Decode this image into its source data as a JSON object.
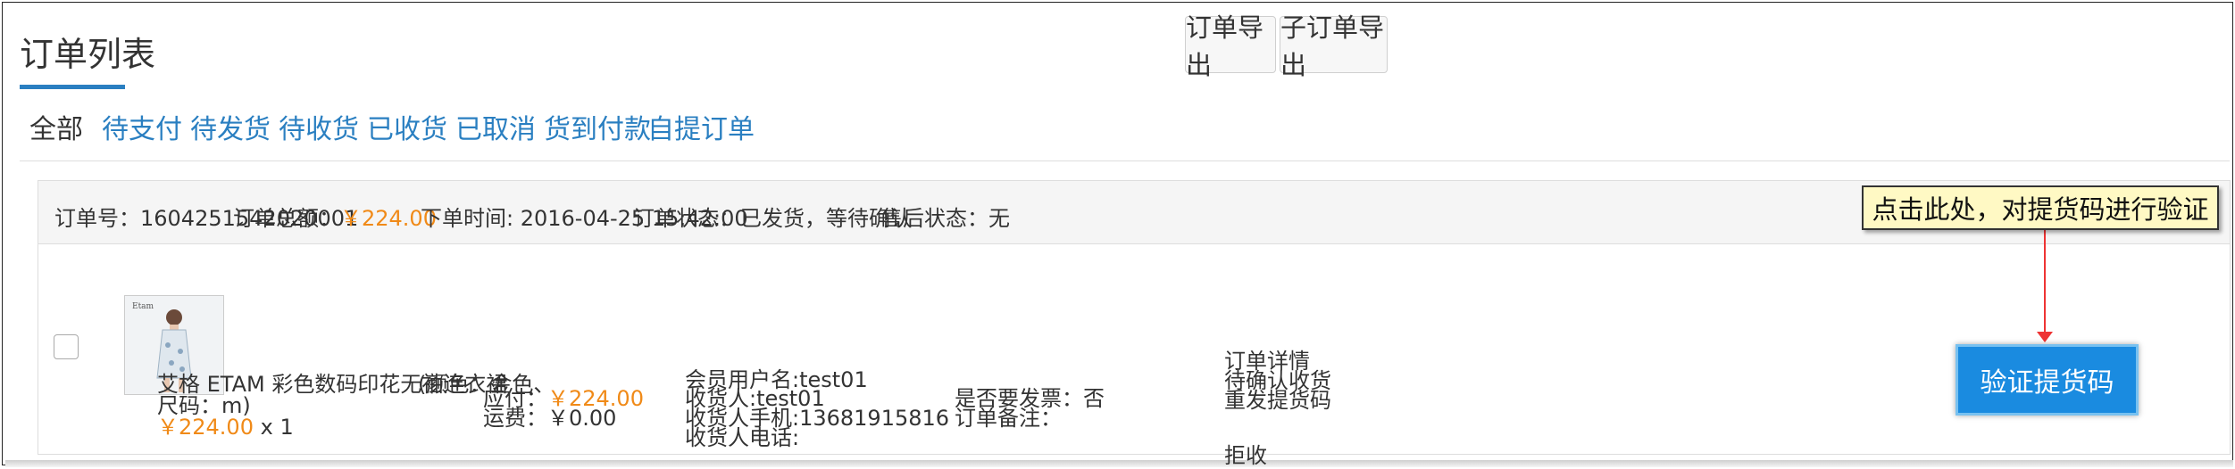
{
  "page": {
    "title": "订单列表"
  },
  "toolbar": {
    "export_orders": "订单导出",
    "export_suborders": "子订单导出"
  },
  "tabs": [
    {
      "label": "全部"
    },
    {
      "label": "待支付"
    },
    {
      "label": "待发货"
    },
    {
      "label": "待收货"
    },
    {
      "label": "已收货"
    },
    {
      "label": "已取消"
    },
    {
      "label": "货到付款"
    },
    {
      "label": "自提订单"
    }
  ],
  "order": {
    "header": {
      "order_no_label": "订单号：",
      "order_no": "1604251542020001",
      "total_label": "订单总额：",
      "total": "￥224.00",
      "time_label": "下单时间: ",
      "time": "2016-04-25 15:42:00",
      "status_label": "订单状态：",
      "status": "已发货，等待确认",
      "aftersale_label": "售后状态：",
      "aftersale": "无"
    },
    "product": {
      "name": "艾格 ETAM 彩色数码印花无袖连衣裙",
      "spec_part1": "(颜色：金色、",
      "spec_part2": "尺码：m)",
      "price": "￥224.00",
      "qty": "x 1",
      "thumb_brand": "Etam"
    },
    "payment": {
      "payable_label": "应付：",
      "payable": "￥224.00",
      "shipping_label": "运费：",
      "shipping": "￥0.00"
    },
    "member": {
      "username": "会员用户名:test01",
      "receiver": "收货人:test01",
      "mobile": "收货人手机:13681915816",
      "phone": "收货人电话:"
    },
    "invoice": {
      "invoice_label": "是否要发票：",
      "invoice": "否",
      "remark_label": "订单备注："
    },
    "actions": {
      "details": "订单详情",
      "pending_confirm": "待确认收货",
      "resend_code": "重发提货码",
      "verify_code": "验证提货码",
      "reject": "拒收"
    }
  },
  "tooltip": {
    "text": "点击此处，对提货码进行验证"
  },
  "colors": {
    "accent": "#2a7fc1",
    "price": "#f08a18",
    "button": "#1a8be0",
    "tooltip_bg": "#fff9c4",
    "arrow": "#e33333"
  }
}
